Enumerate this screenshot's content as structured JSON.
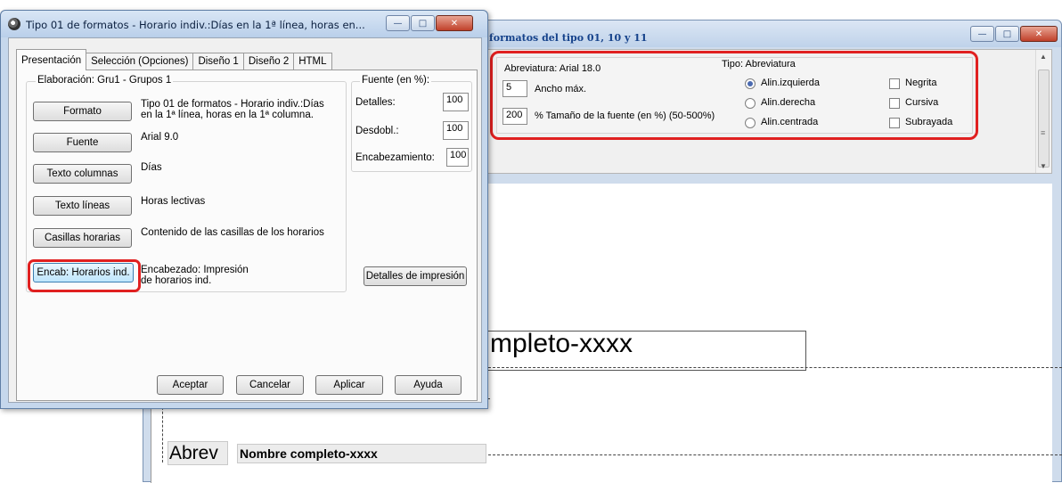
{
  "bg_window": {
    "title": "formatos del tipo 01, 10 y 11",
    "options": {
      "abreviatura_label": "Abreviatura: Arial 18.0",
      "tipo_label": "Tipo: Abreviatura",
      "ancho_value": "5",
      "ancho_label": "Ancho máx.",
      "size_value": "200",
      "size_label": "%  Tamaño de la fuente (en %) (50-500%)",
      "align_options": [
        {
          "label": "Alin.izquierda",
          "selected": true
        },
        {
          "label": "Alin.derecha",
          "selected": false
        },
        {
          "label": "Alin.centrada",
          "selected": false
        }
      ],
      "style_options": [
        {
          "label": "Negrita",
          "checked": false
        },
        {
          "label": "Cursiva",
          "checked": false
        },
        {
          "label": "Subrayada",
          "checked": false
        }
      ]
    },
    "canvas": {
      "big_text": "mpleto-xxxx",
      "abrev_text": "Abrev",
      "nombre_text": "Nombre completo-xxxx"
    }
  },
  "dialog": {
    "title": "Tipo 01 de formatos - Horario indiv.:Días en la 1ª línea, horas en...",
    "tabs": [
      "Presentación",
      "Selección (Opciones)",
      "Diseño 1",
      "Diseño 2",
      "HTML"
    ],
    "elaboracion_title": "Elaboración: Gru1 - Grupos 1",
    "rows": [
      {
        "button": "Formato",
        "desc1": "Tipo 01 de formatos - Horario indiv.:Días",
        "desc2": "en la 1ª línea, horas en la 1ª columna."
      },
      {
        "button": "Fuente",
        "desc1": "Arial 9.0",
        "desc2": ""
      },
      {
        "button": "Texto columnas",
        "desc1": "Días",
        "desc2": ""
      },
      {
        "button": "Texto líneas",
        "desc1": "Horas lectivas",
        "desc2": ""
      },
      {
        "button": "Casillas horarias",
        "desc1": "Contenido de las casillas de los horarios",
        "desc2": ""
      },
      {
        "button": "Encab: Horarios ind.",
        "desc1": "Encabezado: Impresión",
        "desc2": "de horarios ind."
      }
    ],
    "fuente_group": {
      "title": "Fuente (en %):",
      "fields": [
        {
          "label": "Detalles:",
          "value": "100"
        },
        {
          "label": "Desdobl.:",
          "value": "100"
        },
        {
          "label": "Encabezamiento:",
          "value": "100"
        }
      ]
    },
    "detalles_button": "Detalles de impresión",
    "footer_buttons": [
      "Aceptar",
      "Cancelar",
      "Aplicar",
      "Ayuda"
    ]
  }
}
